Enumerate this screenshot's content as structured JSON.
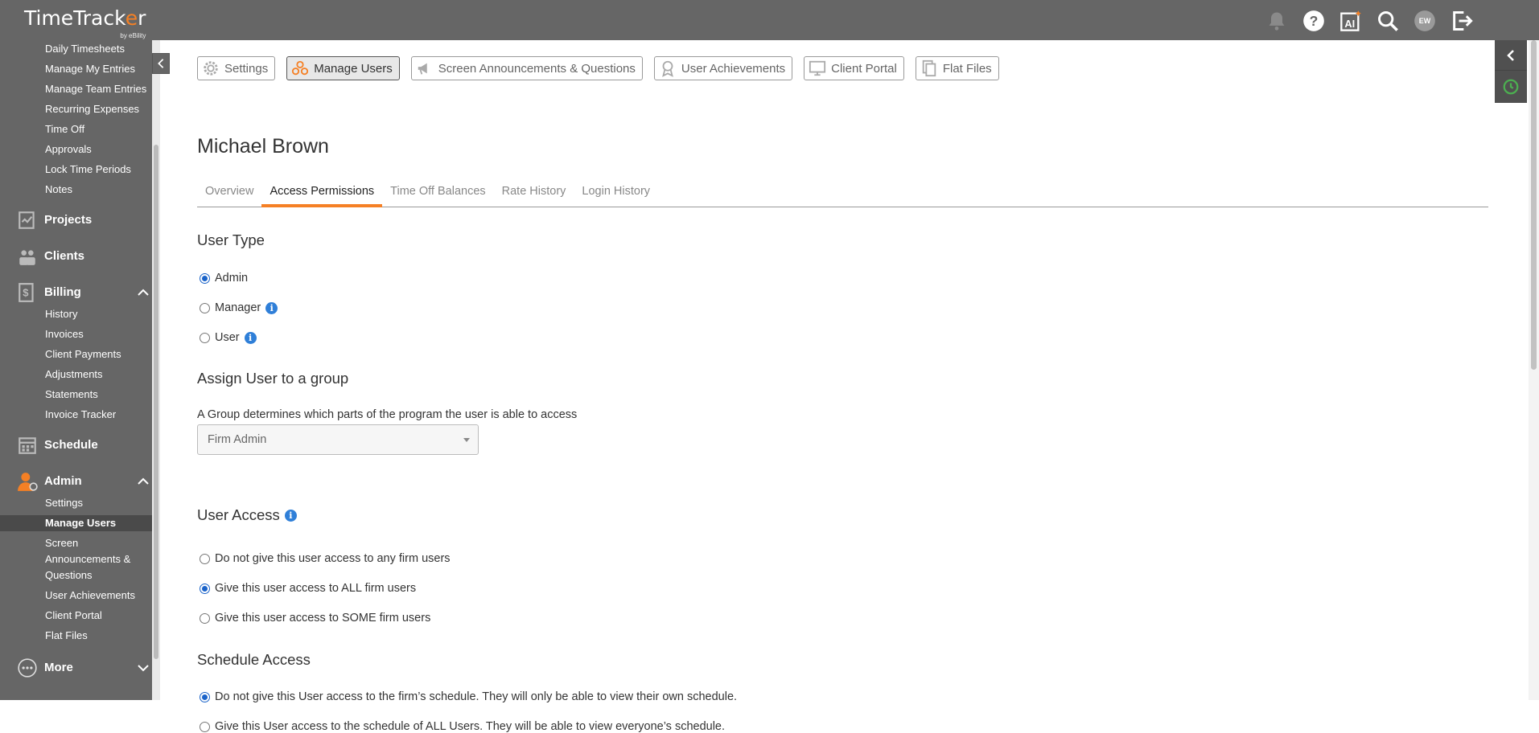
{
  "app": {
    "logo_name_pre": "TimeTrack",
    "logo_name_o": "e",
    "logo_name_post": "r",
    "logo_by": "by eBility",
    "avatar_initials": "EW"
  },
  "sidebar": {
    "items_top": [
      "Daily Timesheets",
      "Manage My Entries",
      "Manage Team Entries",
      "Recurring Expenses",
      "Time Off",
      "Approvals",
      "Lock Time Periods",
      "Notes"
    ],
    "projects": "Projects",
    "clients": "Clients",
    "billing": "Billing",
    "billing_items": [
      "History",
      "Invoices",
      "Client Payments",
      "Adjustments",
      "Statements",
      "Invoice Tracker"
    ],
    "schedule": "Schedule",
    "admin": "Admin",
    "admin_items": [
      "Settings",
      "Manage Users",
      "Screen",
      "Announcements &",
      "Questions",
      "User Achievements",
      "Client Portal",
      "Flat Files"
    ],
    "more": "More"
  },
  "toolbar": {
    "settings": "Settings",
    "manage_users": "Manage Users",
    "announcements": "Screen Announcements & Questions",
    "achievements": "User Achievements",
    "client_portal": "Client Portal",
    "flat_files": "Flat Files"
  },
  "user": {
    "name": "Michael Brown"
  },
  "tabs": [
    "Overview",
    "Access Permissions",
    "Time Off Balances",
    "Rate History",
    "Login History"
  ],
  "user_type": {
    "heading": "User Type",
    "options": [
      "Admin",
      "Manager",
      "User"
    ],
    "selected": "Admin"
  },
  "group": {
    "heading": "Assign User to a group",
    "description": "A Group determines which parts of the program the user is able to access",
    "value": "Firm Admin"
  },
  "user_access": {
    "heading": "User Access",
    "options": [
      "Do not give this user access to any firm users",
      "Give this user access to ALL firm users",
      "Give this user access to SOME firm users"
    ]
  },
  "schedule_access": {
    "heading": "Schedule Access",
    "options": [
      "Do not give this User access to the firm’s schedule. They will only be able to view their own schedule.",
      "Give this User access to the schedule of ALL Users. They will be able to view everyone’s schedule."
    ]
  },
  "colors": {
    "accent": "#f58025",
    "chrome": "#666666",
    "radio": "#1a63c9",
    "info": "#2f7fd8"
  }
}
